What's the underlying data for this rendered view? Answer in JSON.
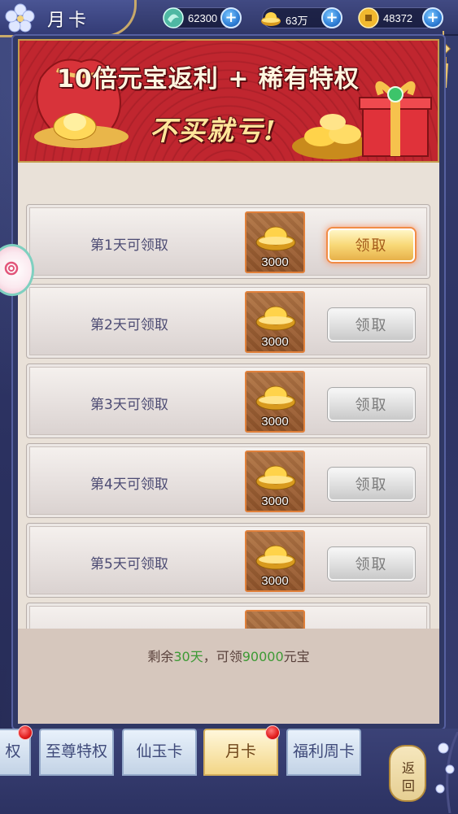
{
  "header": {
    "title": "月卡"
  },
  "currencies": [
    {
      "icon": "jade-icon",
      "value": "62300"
    },
    {
      "icon": "gold-ingot-icon",
      "value": "63万"
    },
    {
      "icon": "copper-coin-icon",
      "value": "48372"
    }
  ],
  "banner": {
    "line1": "10倍元宝返利 + 稀有特权",
    "line2": "不买就亏!"
  },
  "rewards": [
    {
      "label": "第1天可领取",
      "quantity": "3000",
      "button": "领取",
      "state": "active"
    },
    {
      "label": "第2天可领取",
      "quantity": "3000",
      "button": "领取",
      "state": "disabled"
    },
    {
      "label": "第3天可领取",
      "quantity": "3000",
      "button": "领取",
      "state": "disabled"
    },
    {
      "label": "第4天可领取",
      "quantity": "3000",
      "button": "领取",
      "state": "disabled"
    },
    {
      "label": "第5天可领取",
      "quantity": "3000",
      "button": "领取",
      "state": "disabled"
    }
  ],
  "summary": {
    "prefix": "剩余",
    "days": "30天",
    "middle": "，可领",
    "amount": "90000",
    "suffix": "元宝"
  },
  "tabs": [
    {
      "label": "权",
      "active": false,
      "badge": true
    },
    {
      "label": "至尊特权",
      "active": false,
      "badge": false
    },
    {
      "label": "仙玉卡",
      "active": false,
      "badge": false
    },
    {
      "label": "月卡",
      "active": true,
      "badge": true
    },
    {
      "label": "福利周卡",
      "active": false,
      "badge": false
    }
  ],
  "back_button": {
    "label": "返回"
  },
  "colors": {
    "accent_gold": "#f8d877",
    "highlight_green": "#3d9a35",
    "badge_red": "#e11c1c"
  }
}
